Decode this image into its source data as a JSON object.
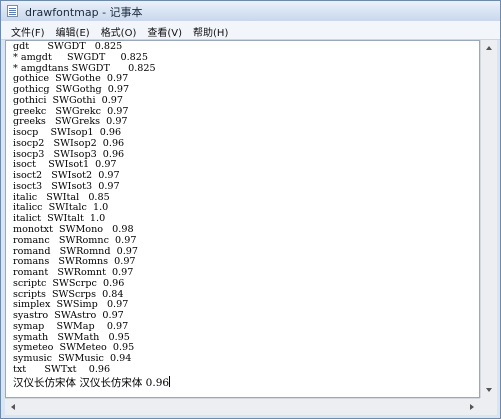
{
  "window": {
    "title": "drawfontmap - 记事本",
    "icon": "notepad-icon"
  },
  "menu": [
    "文件(F)",
    "编辑(E)",
    "格式(O)",
    "查看(V)",
    "帮助(H)"
  ],
  "document": {
    "lines": [
      "gdt      SWGDT   0.825",
      "* amgdt     SWGDT     0.825",
      "* amgdtans SWGDT      0.825",
      "gothice  SWGothe  0.97",
      "gothicg  SWGothg  0.97",
      "gothici  SWGothi  0.97",
      "greekc   SWGrekc  0.97",
      "greeks   SWGreks  0.97",
      "isocp    SWIsop1  0.96",
      "isocp2   SWIsop2  0.96",
      "isocp3   SWIsop3  0.96",
      "isoct    SWIsot1  0.97",
      "isoct2   SWIsot2  0.97",
      "isoct3   SWIsot3  0.97",
      "italic   SWItal   0.85",
      "italicc  SWItalc  1.0",
      "italict  SWItalt  1.0",
      "monotxt  SWMono   0.98",
      "romanc   SWRomnc  0.97",
      "romand   SWRomnd  0.97",
      "romans   SWRomns  0.97",
      "romant   SWRomnt  0.97",
      "scriptc  SWScrpc  0.96",
      "scripts  SWScrps  0.84",
      "simplex  SWSimp   0.97",
      "syastro  SWAstro  0.97",
      "symap    SWMap    0.97",
      "symath   SWMath   0.95",
      "symeteo  SWMeteo  0.95",
      "symusic  SWMusic  0.94",
      "txt      SWTxt    0.96"
    ],
    "last_line": "汉仪长仿宋体 汉仪长仿宋体 0.96"
  }
}
